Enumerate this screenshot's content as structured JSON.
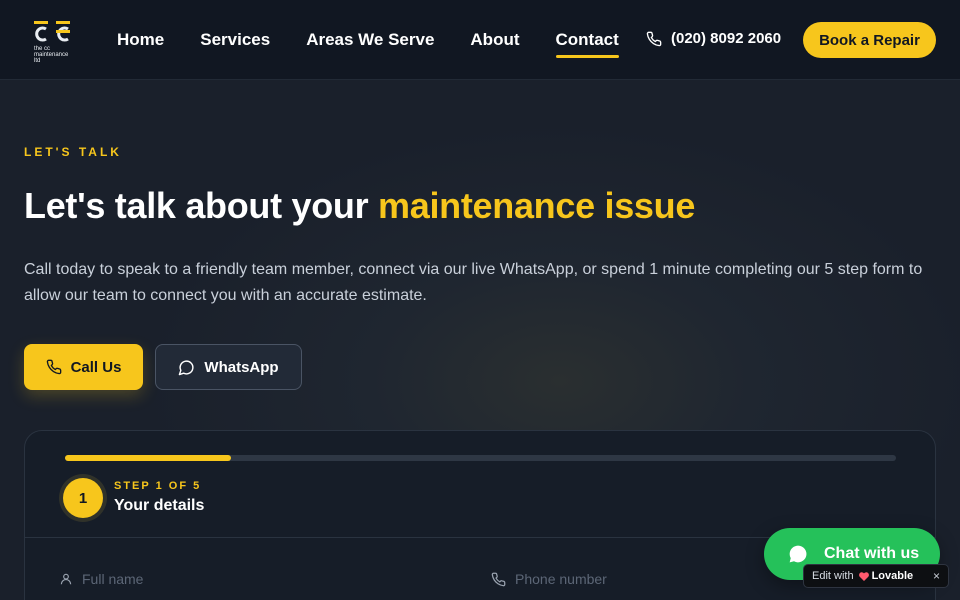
{
  "nav": {
    "logo_text": "the cc maintenance ltd",
    "links": [
      "Home",
      "Services",
      "Areas We Serve",
      "About",
      "Contact"
    ],
    "active_link": "Contact",
    "phone": "(020) 8092 2060",
    "book_label": "Book a Repair"
  },
  "hero": {
    "eyebrow": "LET'S TALK",
    "headline_prefix": "Let's talk about your ",
    "headline_highlight": "maintenance issue",
    "subtext": "Call today to speak to a friendly team member, connect via our live WhatsApp, or spend 1 minute completing our 5 step form to allow our team to connect you with an accurate estimate.",
    "call_label": "Call Us",
    "whatsapp_label": "WhatsApp"
  },
  "form": {
    "progress": 0.2,
    "step_number": "1",
    "step_label": "STEP 1 OF 5",
    "step_title": "Your details",
    "fields": {
      "full_name_placeholder": "Full name",
      "phone_placeholder": "Phone number"
    }
  },
  "chat": {
    "label": "Chat with us"
  },
  "badge": {
    "prefix": "Edit with",
    "brand": "Lovable",
    "close": "×"
  },
  "colors": {
    "accent": "#f7c61c",
    "background": "#1a202b",
    "navbar": "#111722",
    "whatsapp_green": "#25c15a"
  }
}
